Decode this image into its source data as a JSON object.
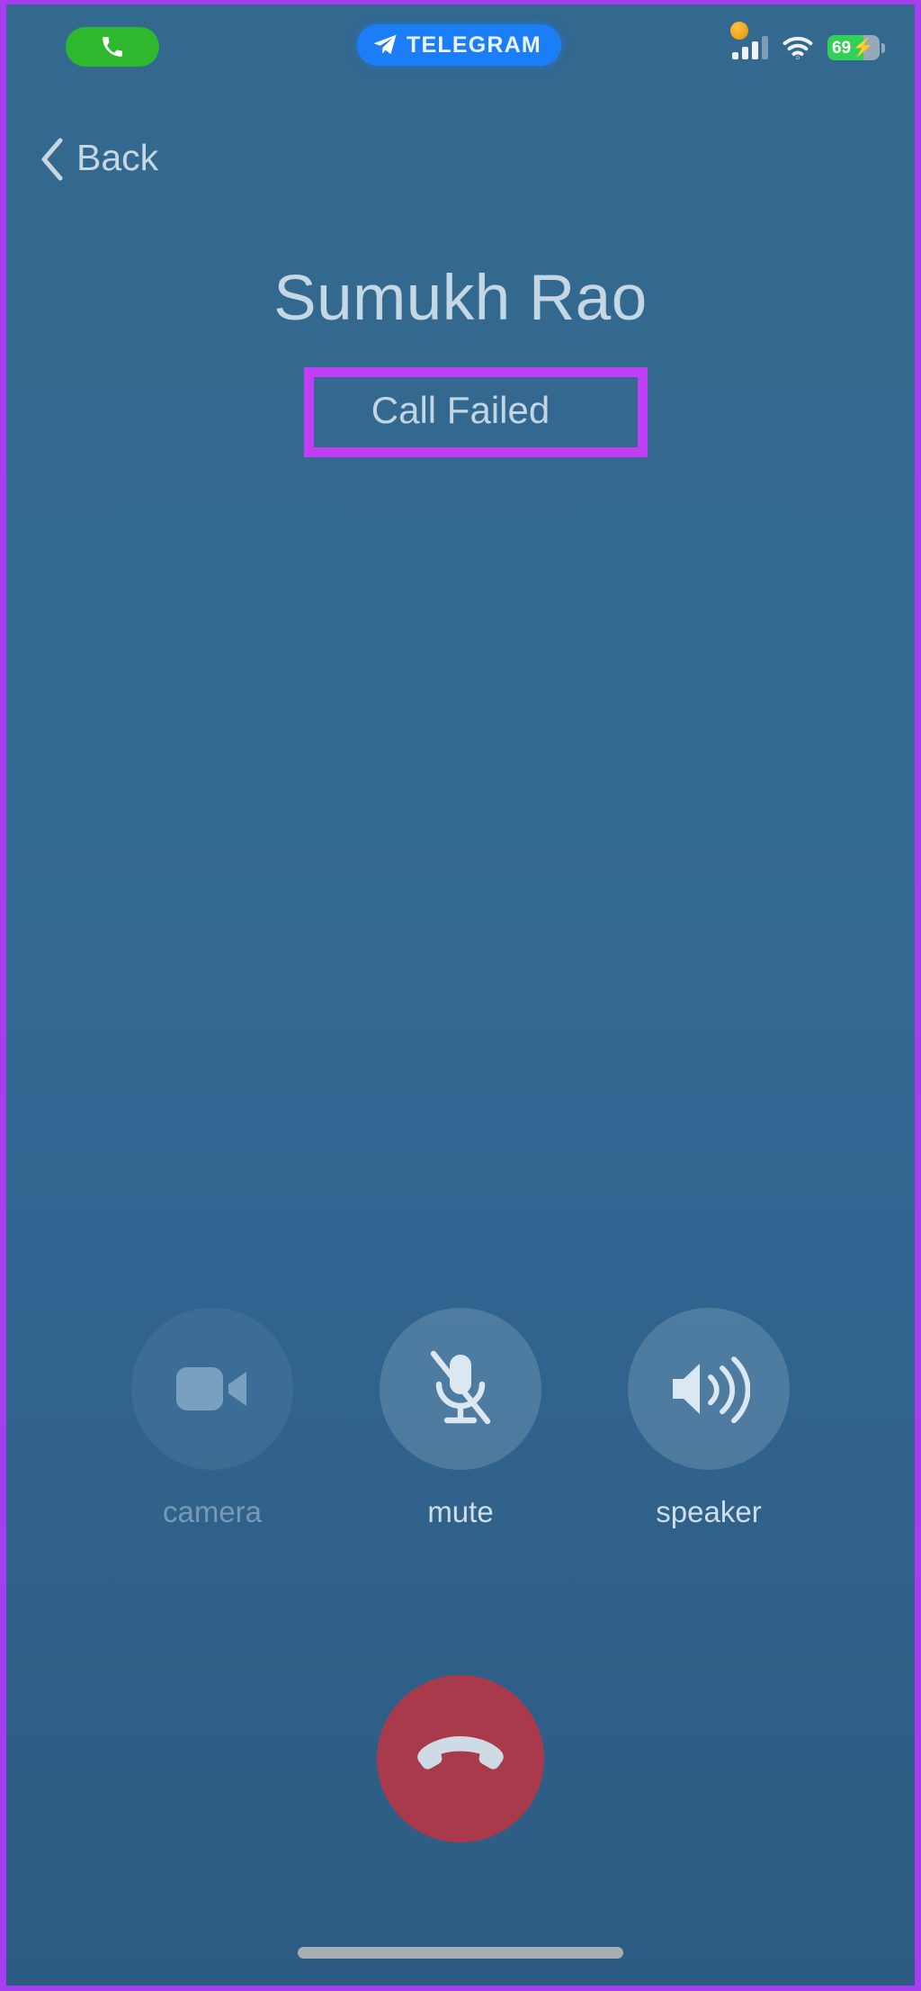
{
  "meta": {
    "app_context": "telegram-voice-call",
    "annotation_color": "#c23ef5",
    "background_color": "#33688f"
  },
  "status_bar": {
    "call_pill": {
      "icon": "phone-handset-icon",
      "color": "#2eb82e"
    },
    "app_pill": {
      "label": "TELEGRAM",
      "icon": "telegram-plane-icon",
      "color": "#1c7ef7"
    },
    "mic_indicator": {
      "name": "microphone-in-use-dot",
      "color": "#f0a31b"
    },
    "cellular": {
      "icon": "signal-bars-icon",
      "bars_active": 3,
      "bars_total": 4
    },
    "wifi": {
      "icon": "wifi-icon"
    },
    "battery": {
      "percent_label": "69",
      "percent_value": 69,
      "charging": true,
      "bolt": "⚡",
      "color": "#31d158"
    }
  },
  "navigation": {
    "back": {
      "label": "Back",
      "icon": "chevron-left-icon"
    }
  },
  "caller": {
    "name": "Sumukh Rao",
    "status": "Call Failed"
  },
  "controls": [
    {
      "key": "camera",
      "label": "camera",
      "icon": "video-camera-icon",
      "enabled": false
    },
    {
      "key": "mute",
      "label": "mute",
      "icon": "microphone-slash-icon",
      "enabled": true
    },
    {
      "key": "speaker",
      "label": "speaker",
      "icon": "speaker-waves-icon",
      "enabled": true
    }
  ],
  "end_call": {
    "label": "End Call",
    "icon": "phone-hangup-icon",
    "color": "#a93a4c"
  },
  "home_indicator": {
    "name": "home-indicator"
  }
}
